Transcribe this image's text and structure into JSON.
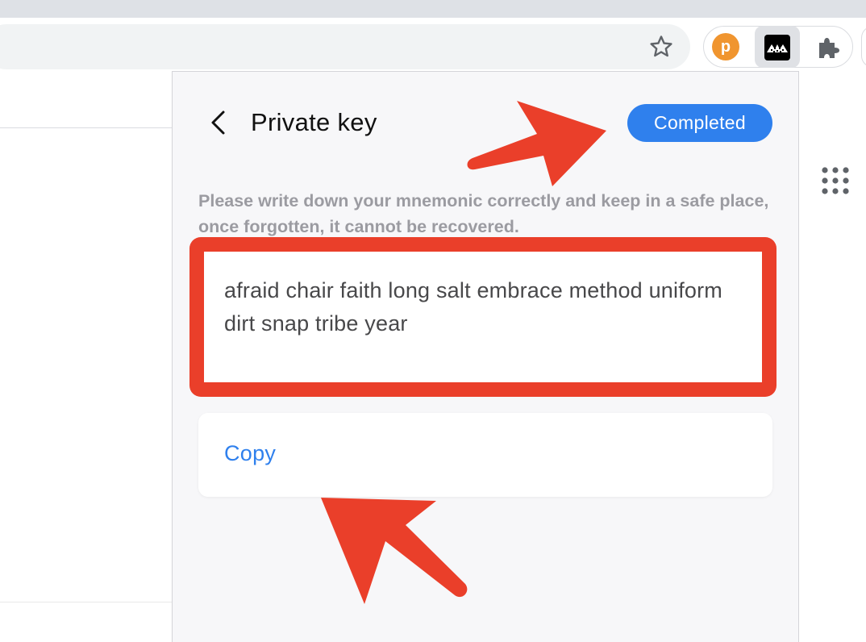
{
  "popup": {
    "title": "Private key",
    "completed_label": "Completed",
    "notice": "Please write down your mnemonic correctly and keep in a safe place, once forgotten, it cannot be recovered.",
    "mnemonic": "afraid chair faith long salt embrace method uniform dirt snap tribe year",
    "copy_label": "Copy"
  },
  "extensions": {
    "p_letter": "p"
  },
  "colors": {
    "accent": "#2f80ed",
    "annotation": "#ea3f2a",
    "popup_bg": "#f7f7f9",
    "notice_text": "#9b9ba1"
  },
  "icons": [
    "back-chevron-icon",
    "star-icon",
    "polkadot-extension-icon",
    "wallet-extension-icon",
    "puzzle-extensions-icon",
    "apps-grid-icon"
  ]
}
